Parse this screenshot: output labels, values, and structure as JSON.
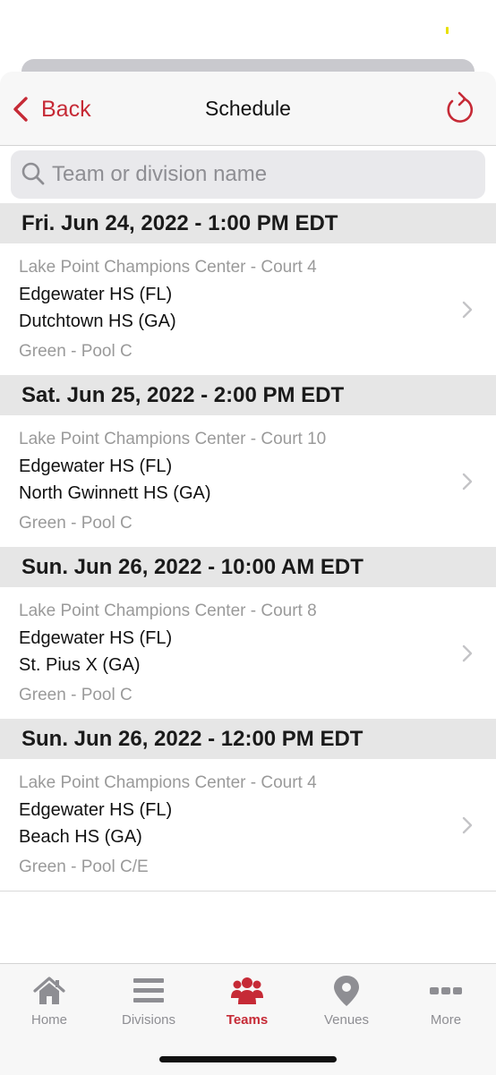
{
  "nav": {
    "back_label": "Back",
    "title": "Schedule"
  },
  "search": {
    "placeholder": "Team or division name",
    "value": ""
  },
  "colors": {
    "accent": "#c62a36",
    "header_bg": "#e6e6e6",
    "secondary_text": "#9a9a9a"
  },
  "schedule": [
    {
      "date": "Fri. Jun 24, 2022 - 1:00 PM EDT",
      "venue": "Lake Point Champions Center - Court 4",
      "team1": "Edgewater HS (FL)",
      "team2": "Dutchtown HS (GA)",
      "pool": "Green - Pool C"
    },
    {
      "date": "Sat. Jun 25, 2022 - 2:00 PM EDT",
      "venue": "Lake Point Champions Center - Court 10",
      "team1": "Edgewater HS (FL)",
      "team2": "North Gwinnett HS (GA)",
      "pool": "Green - Pool C"
    },
    {
      "date": "Sun. Jun 26, 2022 - 10:00 AM EDT",
      "venue": "Lake Point Champions Center - Court 8",
      "team1": "Edgewater HS (FL)",
      "team2": "St. Pius X (GA)",
      "pool": "Green - Pool C"
    },
    {
      "date": "Sun. Jun 26, 2022 - 12:00 PM EDT",
      "venue": "Lake Point Champions Center - Court 4",
      "team1": "Edgewater HS (FL)",
      "team2": "Beach HS (GA)",
      "pool": "Green - Pool C/E"
    }
  ],
  "tabs": [
    {
      "label": "Home",
      "icon": "home-icon"
    },
    {
      "label": "Divisions",
      "icon": "list-icon"
    },
    {
      "label": "Teams",
      "icon": "people-icon",
      "active": true
    },
    {
      "label": "Venues",
      "icon": "map-pin-icon"
    },
    {
      "label": "More",
      "icon": "more-icon"
    }
  ]
}
